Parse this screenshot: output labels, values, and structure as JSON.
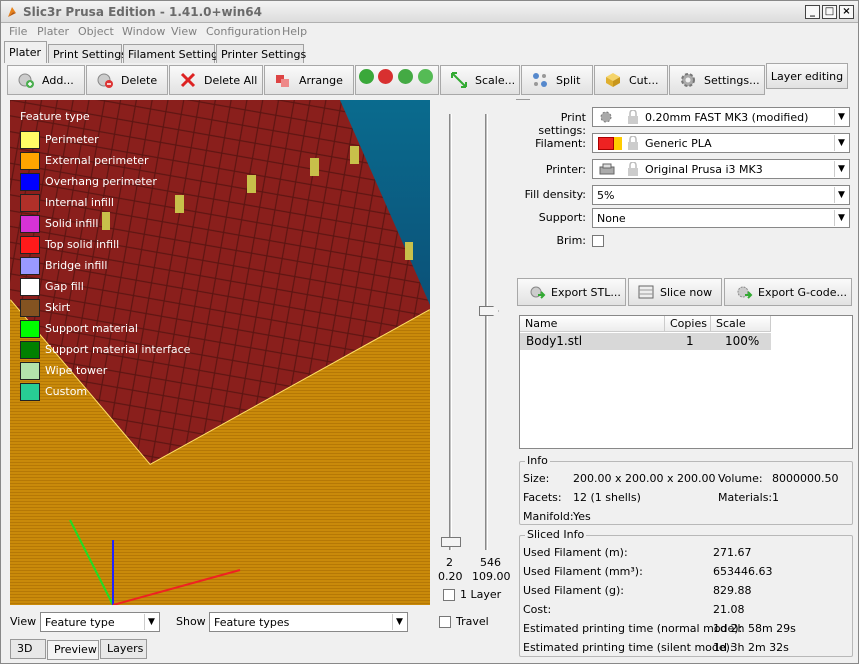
{
  "window": {
    "title": "Slic3r Prusa Edition - 1.41.0+win64"
  },
  "menu": [
    "File",
    "Plater",
    "Object",
    "Window",
    "View",
    "Configuration",
    "Help"
  ],
  "tabs": [
    "Plater",
    "Print Settings",
    "Filament Settings",
    "Printer Settings"
  ],
  "toolbar": {
    "add": "Add...",
    "delete": "Delete",
    "delete_all": "Delete All",
    "arrange": "Arrange",
    "scale": "Scale...",
    "split": "Split",
    "cut": "Cut...",
    "settings": "Settings...",
    "layer_editing": "Layer editing"
  },
  "legend": {
    "title": "Feature type",
    "items": [
      {
        "label": "Perimeter",
        "color": "#ffff66"
      },
      {
        "label": "External perimeter",
        "color": "#ffa500"
      },
      {
        "label": "Overhang perimeter",
        "color": "#0000ff"
      },
      {
        "label": "Internal infill",
        "color": "#b03029"
      },
      {
        "label": "Solid infill",
        "color": "#d732d7"
      },
      {
        "label": "Top solid infill",
        "color": "#ff1a1a"
      },
      {
        "label": "Bridge infill",
        "color": "#9999ff"
      },
      {
        "label": "Gap fill",
        "color": "#ffffff"
      },
      {
        "label": "Skirt",
        "color": "#845321"
      },
      {
        "label": "Support material",
        "color": "#00ff00"
      },
      {
        "label": "Support material interface",
        "color": "#008000"
      },
      {
        "label": "Wipe tower",
        "color": "#b3e3ab"
      },
      {
        "label": "Custom",
        "color": "#28cc94"
      }
    ]
  },
  "slider": {
    "bottom_layer": "2",
    "top_layer": "546",
    "bottom_z": "0.20",
    "top_z": "109.00",
    "one_layer_label": "1 Layer",
    "travel_label": "Travel"
  },
  "bottom": {
    "view_label": "View",
    "view_value": "Feature type",
    "show_label": "Show",
    "show_value": "Feature types"
  },
  "bottom_tabs": [
    "3D",
    "Preview",
    "Layers"
  ],
  "settings": {
    "print_label": "Print settings:",
    "print_value": "0.20mm FAST MK3 (modified)",
    "filament_label": "Filament:",
    "filament_value": "Generic PLA",
    "printer_label": "Printer:",
    "printer_value": "Original Prusa i3 MK3",
    "fill_label": "Fill density:",
    "fill_value": "5%",
    "support_label": "Support:",
    "support_value": "None",
    "brim_label": "Brim:"
  },
  "actions": {
    "export_stl": "Export STL...",
    "slice_now": "Slice now",
    "export_gcode": "Export G-code..."
  },
  "objects": {
    "headers": [
      "Name",
      "Copies",
      "Scale"
    ],
    "rows": [
      {
        "name": "Body1.stl",
        "copies": "1",
        "scale": "100%"
      }
    ]
  },
  "info": {
    "title": "Info",
    "size_label": "Size:",
    "size_value": "200.00 x 200.00 x 200.00",
    "volume_label": "Volume:",
    "volume_value": "8000000.50",
    "facets_label": "Facets:",
    "facets_value": "12 (1 shells)",
    "materials_label": "Materials:",
    "materials_value": "1",
    "manifold_label": "Manifold:",
    "manifold_value": "Yes"
  },
  "sliced": {
    "title": "Sliced Info",
    "rows": [
      {
        "label": "Used Filament (m):",
        "value": "271.67"
      },
      {
        "label": "Used Filament (mm³):",
        "value": "653446.63"
      },
      {
        "label": "Used Filament (g):",
        "value": "829.88"
      },
      {
        "label": "Cost:",
        "value": "21.08"
      },
      {
        "label": "Estimated printing time (normal mode):",
        "value": "1d 2h 58m 29s"
      },
      {
        "label": "Estimated printing time (silent mode):",
        "value": "1d 3h 2m 32s"
      }
    ]
  }
}
